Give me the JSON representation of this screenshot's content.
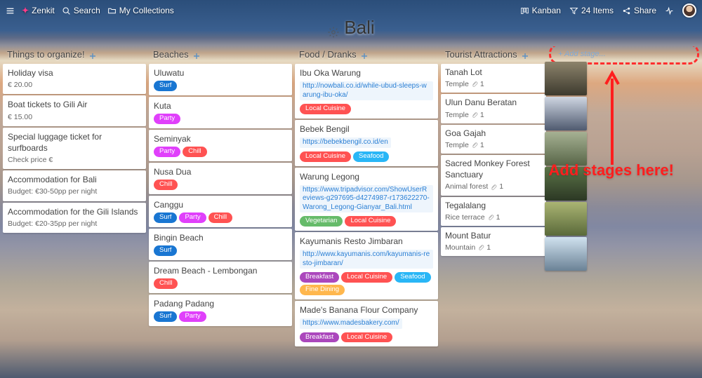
{
  "topbar": {
    "brand": "Zenkit",
    "search": "Search",
    "collections": "My Collections",
    "kanban": "Kanban",
    "items_count": "24 Items",
    "share": "Share"
  },
  "board_title": "Bali",
  "columns": [
    {
      "title": "Things to organize!",
      "cards": [
        {
          "title": "Holiday visa",
          "sub": "€ 20.00"
        },
        {
          "title": "Boat tickets to Gili Air",
          "sub": "€ 15.00"
        },
        {
          "title": "Special luggage ticket for surfboards",
          "sub": "Check price €"
        },
        {
          "title": "Accommodation for Bali",
          "sub": "Budget: €30-50pp per night"
        },
        {
          "title": "Accommodation for the Gili Islands",
          "sub": "Budget: €20-35pp per night"
        }
      ]
    },
    {
      "title": "Beaches",
      "cards": [
        {
          "title": "Uluwatu",
          "tags": [
            "Surf"
          ]
        },
        {
          "title": "Kuta",
          "tags": [
            "Party"
          ]
        },
        {
          "title": "Seminyak",
          "tags": [
            "Party",
            "Chill"
          ]
        },
        {
          "title": "Nusa Dua",
          "tags": [
            "Chill"
          ]
        },
        {
          "title": "Canggu",
          "tags": [
            "Surf",
            "Party",
            "Chill"
          ]
        },
        {
          "title": "Bingin Beach",
          "tags": [
            "Surf"
          ]
        },
        {
          "title": "Dream Beach - Lembongan",
          "tags": [
            "Chill"
          ]
        },
        {
          "title": "Padang Padang",
          "tags": [
            "Surf",
            "Party"
          ]
        }
      ]
    },
    {
      "title": "Food / Dranks",
      "cards": [
        {
          "title": "Ibu Oka Warung",
          "link": "http://nowbali.co.id/while-ubud-sleeps-warung-ibu-oka/",
          "tags": [
            "Local Cuisine"
          ]
        },
        {
          "title": "Bebek Bengil",
          "link": "https://bebekbengil.co.id/en",
          "tags": [
            "Local Cuisine",
            "Seafood"
          ]
        },
        {
          "title": "Warung Legong",
          "link": "https://www.tripadvisor.com/ShowUserReviews-g297695-d4274987-r173622270-Warong_Legong-Gianyar_Bali.html",
          "tags": [
            "Vegetarian",
            "Local Cuisine"
          ]
        },
        {
          "title": "Kayumanis Resto Jimbaran",
          "link": "http://www.kayumanis.com/kayumanis-resto-jimbaran/",
          "tags": [
            "Breakfast",
            "Local Cuisine",
            "Seafood",
            "Fine Dining"
          ]
        },
        {
          "title": "Made's Banana Flour Company",
          "link": "https://www.madesbakery.com/",
          "tags": [
            "Breakfast",
            "Local Cuisine"
          ]
        }
      ]
    },
    {
      "title": "Tourist Attractions",
      "cards": [
        {
          "title": "Tanah Lot",
          "meta_label": "Temple",
          "attach_count": "1"
        },
        {
          "title": "Ulun Danu Beratan",
          "meta_label": "Temple",
          "attach_count": "1"
        },
        {
          "title": "Goa Gajah",
          "meta_label": "Temple",
          "attach_count": "1"
        },
        {
          "title": "Sacred Monkey Forest Sanctuary",
          "meta_label": "Animal forest",
          "attach_count": "1"
        },
        {
          "title": "Tegalalang",
          "meta_label": "Rice terrace",
          "attach_count": "1"
        },
        {
          "title": "Mount Batur",
          "meta_label": "Mountain",
          "attach_count": "1"
        }
      ]
    }
  ],
  "add_stage_placeholder": "+ Add stage...",
  "cta_text": "Add stages here!",
  "tag_map": {
    "Surf": "tag-surf",
    "Party": "tag-party",
    "Chill": "tag-chill",
    "Local Cuisine": "tag-local",
    "Seafood": "tag-seafood",
    "Vegetarian": "tag-vegetarian",
    "Breakfast": "tag-breakfast",
    "Fine Dining": "tag-finedining"
  }
}
